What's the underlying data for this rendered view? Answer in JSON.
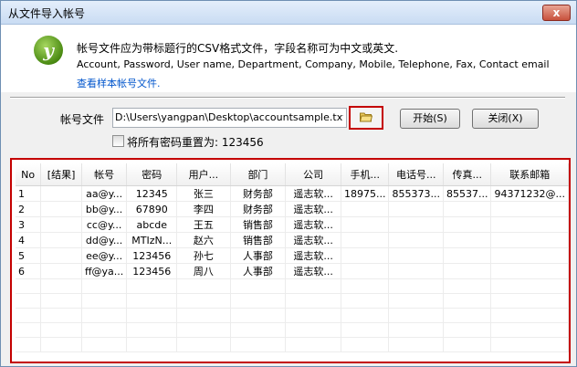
{
  "window": {
    "title": "从文件导入帐号",
    "close_glyph": "x"
  },
  "header": {
    "line1": "帐号文件应为带标题行的CSV格式文件，字段名称可为中文或英文.",
    "line2": "Account, Password, User name, Department, Company, Mobile, Telephone, Fax, Contact email",
    "link": "查看样本帐号文件."
  },
  "form": {
    "file_label": "帐号文件",
    "file_path": "D:\\Users\\yangpan\\Desktop\\accountsample.txt",
    "start_label": "开始(S)",
    "close_label": "关闭(X)",
    "reset_label": "将所有密码重置为: 123456"
  },
  "table": {
    "columns": [
      "No",
      "[结果]",
      "帐号",
      "密码",
      "用户...",
      "部门",
      "公司",
      "手机...",
      "电话号...",
      "传真...",
      "联系邮箱"
    ],
    "rows": [
      [
        "1",
        "",
        "aa@y...",
        "12345",
        "张三",
        "财务部",
        "遥志软...",
        "18975...",
        "855373...",
        "85537...",
        "94371232@..."
      ],
      [
        "2",
        "",
        "bb@y...",
        "67890",
        "李四",
        "财务部",
        "遥志软...",
        "",
        "",
        "",
        ""
      ],
      [
        "3",
        "",
        "cc@y...",
        "abcde",
        "王五",
        "销售部",
        "遥志软...",
        "",
        "",
        "",
        ""
      ],
      [
        "4",
        "",
        "dd@y...",
        "MTIzN...",
        "赵六",
        "销售部",
        "遥志软...",
        "",
        "",
        "",
        ""
      ],
      [
        "5",
        "",
        "ee@y...",
        "123456",
        "孙七",
        "人事部",
        "遥志软...",
        "",
        "",
        "",
        ""
      ],
      [
        "6",
        "",
        "ff@ya...",
        "123456",
        "周八",
        "人事部",
        "遥志软...",
        "",
        "",
        "",
        ""
      ],
      [
        "",
        "",
        "",
        "",
        "",
        "",
        "",
        "",
        "",
        "",
        ""
      ],
      [
        "",
        "",
        "",
        "",
        "",
        "",
        "",
        "",
        "",
        "",
        ""
      ],
      [
        "",
        "",
        "",
        "",
        "",
        "",
        "",
        "",
        "",
        "",
        ""
      ],
      [
        "",
        "",
        "",
        "",
        "",
        "",
        "",
        "",
        "",
        "",
        ""
      ],
      [
        "",
        "",
        "",
        "",
        "",
        "",
        "",
        "",
        "",
        "",
        ""
      ]
    ]
  },
  "icons": {
    "logo": "app-logo-icon",
    "browse": "folder-open-icon"
  },
  "colors": {
    "highlight": "#c40000",
    "link": "#0055cc"
  }
}
